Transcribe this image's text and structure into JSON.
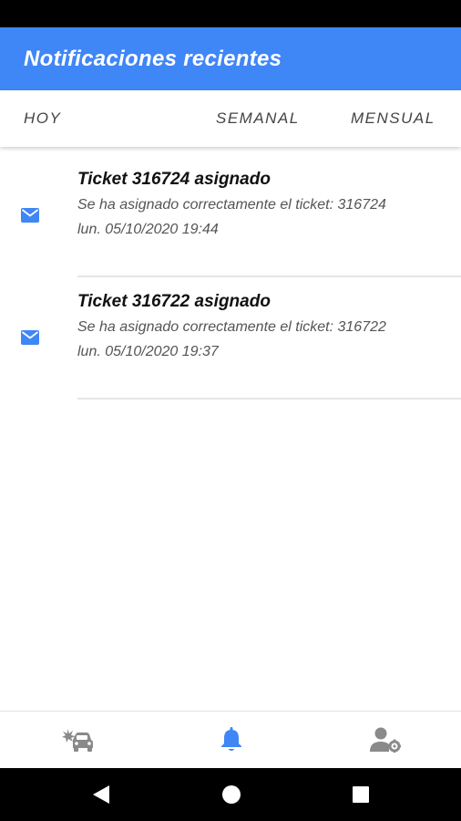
{
  "app_bar": {
    "title": "Notificaciones recientes",
    "color": "#3f86f7"
  },
  "tabs": [
    {
      "label": "HOY"
    },
    {
      "label": "SEMANAL"
    },
    {
      "label": "MENSUAL"
    }
  ],
  "notifications": [
    {
      "icon": "mail-icon",
      "title": "Ticket 316724 asignado",
      "body": "Se ha asignado correctamente el ticket: 316724",
      "date": "lun. 05/10/2020 19:44"
    },
    {
      "icon": "mail-icon",
      "title": "Ticket 316722 asignado",
      "body": "Se ha asignado correctamente el ticket: 316722",
      "date": "lun. 05/10/2020 19:37"
    }
  ],
  "bottom_nav": {
    "items": [
      {
        "icon": "car-crash-icon",
        "active": false
      },
      {
        "icon": "bell-icon",
        "active": true
      },
      {
        "icon": "user-settings-icon",
        "active": false
      }
    ],
    "active_color": "#3f86f7",
    "inactive_color": "#8a8a8a"
  },
  "system_nav": {
    "items": [
      {
        "icon": "back-triangle-icon"
      },
      {
        "icon": "home-circle-icon"
      },
      {
        "icon": "recents-square-icon"
      }
    ]
  }
}
